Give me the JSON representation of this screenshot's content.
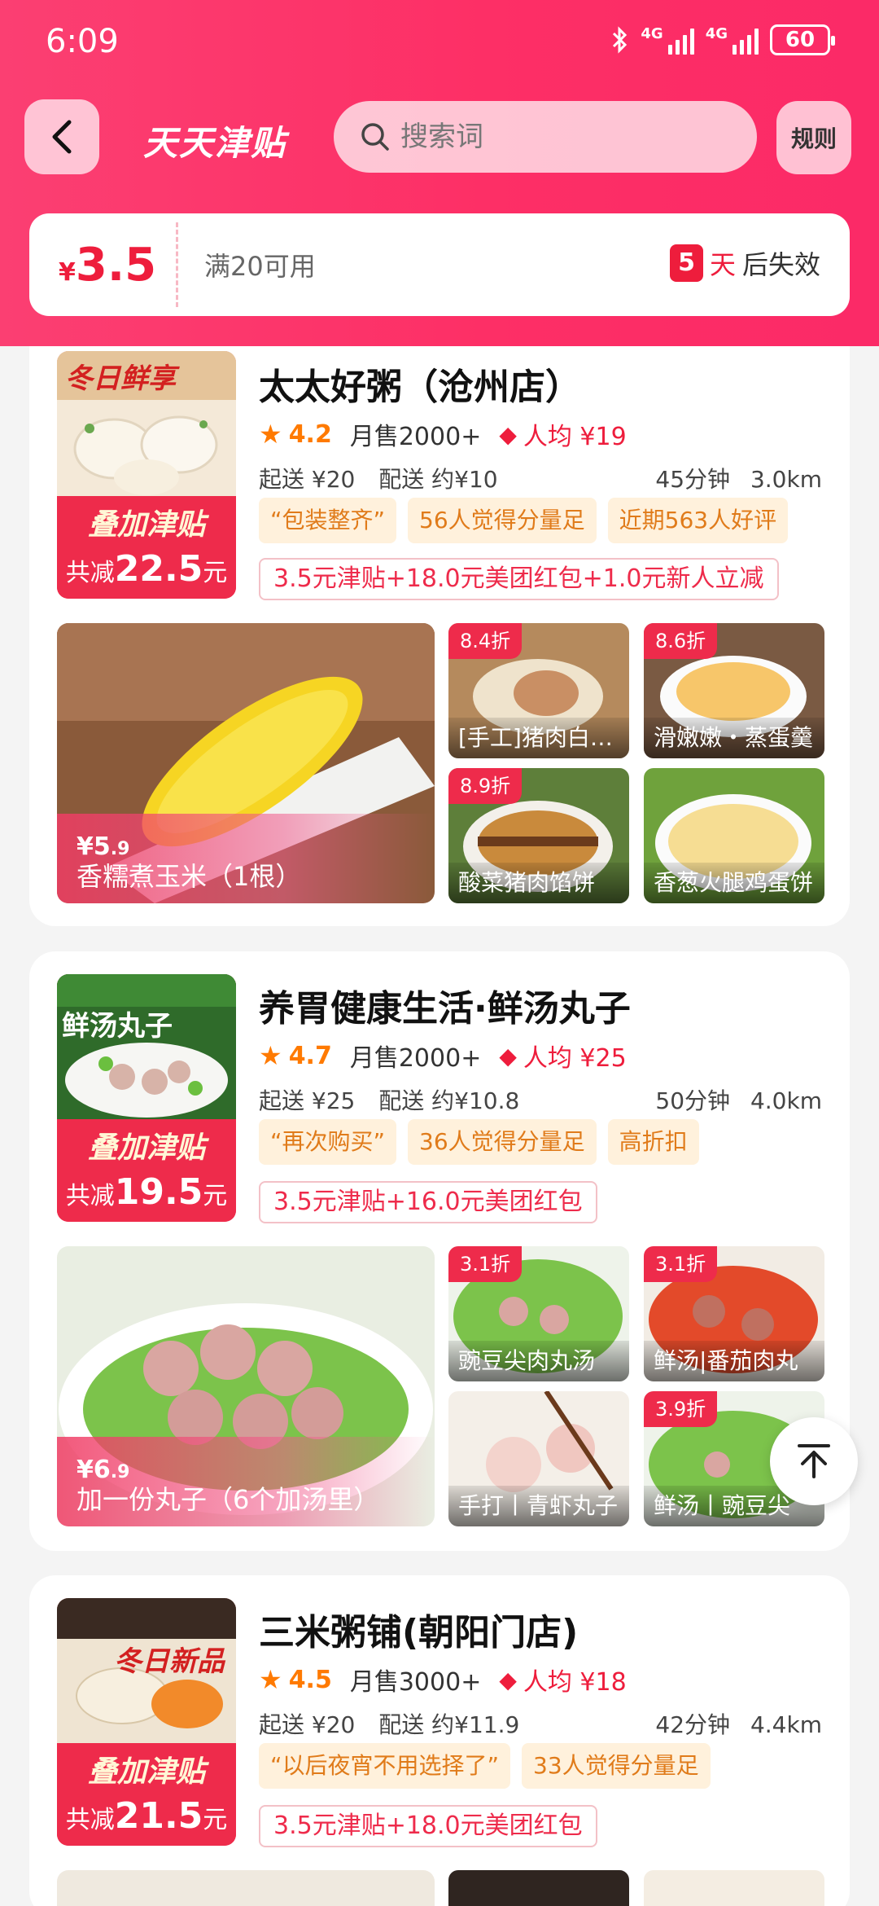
{
  "status_bar": {
    "time": "6:09",
    "network1": "4G",
    "network2": "4G",
    "battery": "60"
  },
  "nav": {
    "title": "天天津贴",
    "search_placeholder": "搜索词",
    "rules_label": "规则"
  },
  "coupon": {
    "currency": "¥",
    "amount": "3.5",
    "condition": "满20可用",
    "days": "5",
    "days_unit": "天",
    "expire_text": "后失效"
  },
  "stores": [
    {
      "name": "太太好粥（沧州店）",
      "rating": "4.2",
      "monthly_sales": "月售2000+",
      "avg_price": "人均 ¥19",
      "min_order": "起送 ¥20",
      "delivery_fee": "配送 约¥10",
      "delivery_time": "45分钟",
      "distance": "3.0km",
      "tags": [
        "“包装整齐”",
        "56人觉得分量足",
        "近期563人好评"
      ],
      "promo": "3.5元津贴+18.0元美团红包+1.0元新人立减",
      "thumb_caption": "冬日鲜享",
      "badge_title": "叠加津贴",
      "badge_prefix": "共减",
      "badge_amount": "22.5",
      "badge_unit": "元",
      "main_product": {
        "currency": "¥",
        "price_int": "5",
        "price_dec": ".9",
        "name": "香糯煮玉米（1根）"
      },
      "products": [
        {
          "discount": "8.4折",
          "name": "[手工]猪肉白菜大包"
        },
        {
          "discount": "8.6折",
          "name": "滑嫩嫩・蒸蛋羹"
        },
        {
          "discount": "8.9折",
          "name": "酸菜猪肉馅饼"
        },
        {
          "discount": "",
          "name": "香葱火腿鸡蛋饼"
        }
      ]
    },
    {
      "name": "养胃健康生活·鲜汤丸子",
      "rating": "4.7",
      "monthly_sales": "月售2000+",
      "avg_price": "人均 ¥25",
      "min_order": "起送 ¥25",
      "delivery_fee": "配送 约¥10.8",
      "delivery_time": "50分钟",
      "distance": "4.0km",
      "tags": [
        "“再次购买”",
        "36人觉得分量足",
        "高折扣"
      ],
      "promo": "3.5元津贴+16.0元美团红包",
      "thumb_caption": "鲜汤丸子",
      "badge_title": "叠加津贴",
      "badge_prefix": "共减",
      "badge_amount": "19.5",
      "badge_unit": "元",
      "main_product": {
        "currency": "¥",
        "price_int": "6",
        "price_dec": ".9",
        "name": "加一份丸子（6个加汤里）"
      },
      "products": [
        {
          "discount": "3.1折",
          "name": "豌豆尖肉丸汤"
        },
        {
          "discount": "3.1折",
          "name": "鲜汤|番茄肉丸"
        },
        {
          "discount": "",
          "name": "手打丨青虾丸子"
        },
        {
          "discount": "3.9折",
          "name": "鲜汤丨豌豆尖"
        }
      ]
    },
    {
      "name": "三米粥铺(朝阳门店)",
      "rating": "4.5",
      "monthly_sales": "月售3000+",
      "avg_price": "人均 ¥18",
      "min_order": "起送 ¥20",
      "delivery_fee": "配送 约¥11.9",
      "delivery_time": "42分钟",
      "distance": "4.4km",
      "tags": [
        "“以后夜宵不用选择了”",
        "33人觉得分量足"
      ],
      "promo": "3.5元津贴+18.0元美团红包",
      "thumb_caption": "冬日新品",
      "badge_title": "叠加津贴",
      "badge_prefix": "共减",
      "badge_amount": "21.5",
      "badge_unit": "元"
    }
  ],
  "colors": {
    "header": "#fb3f72",
    "accent": "#ee1d3c",
    "tag_bg": "#fff1dc",
    "tag_text": "#e07b1a",
    "rating": "#ff7a00"
  }
}
